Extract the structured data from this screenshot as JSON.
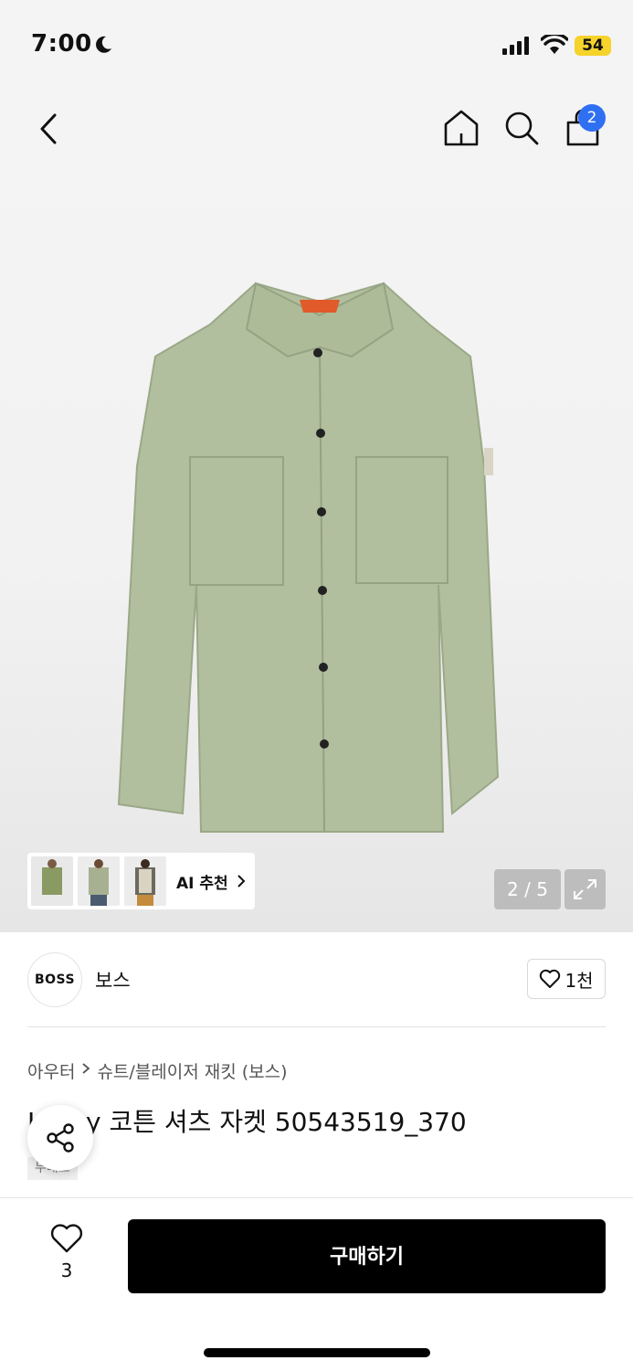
{
  "status_bar": {
    "time": "7:00",
    "battery": "54"
  },
  "nav": {
    "cart_badge": "2"
  },
  "gallery": {
    "pager": "2 / 5",
    "ai_label": "AI 추천"
  },
  "brand": {
    "logo_text": "BOSS",
    "name": "보스",
    "favorite_count": "1천"
  },
  "breadcrumb": {
    "category": "아우터",
    "subcategory": "슈트/블레이저 재킷 (보스)"
  },
  "product": {
    "title": "Lovky 코튼 셔츠 자켓 50543519_370",
    "tag": "무배포"
  },
  "bottom": {
    "like_count": "3",
    "buy_label": "구매하기"
  },
  "colors": {
    "accent_badge": "#2f6ff2",
    "battery": "#f5d32b",
    "jacket": "#b2bf9e",
    "buy_button": "#000000"
  },
  "icons": [
    "moon-icon",
    "signal-icon",
    "wifi-icon",
    "back-icon",
    "home-icon",
    "search-icon",
    "bag-icon",
    "expand-icon",
    "heart-icon",
    "share-icon",
    "chevron-right-icon"
  ]
}
